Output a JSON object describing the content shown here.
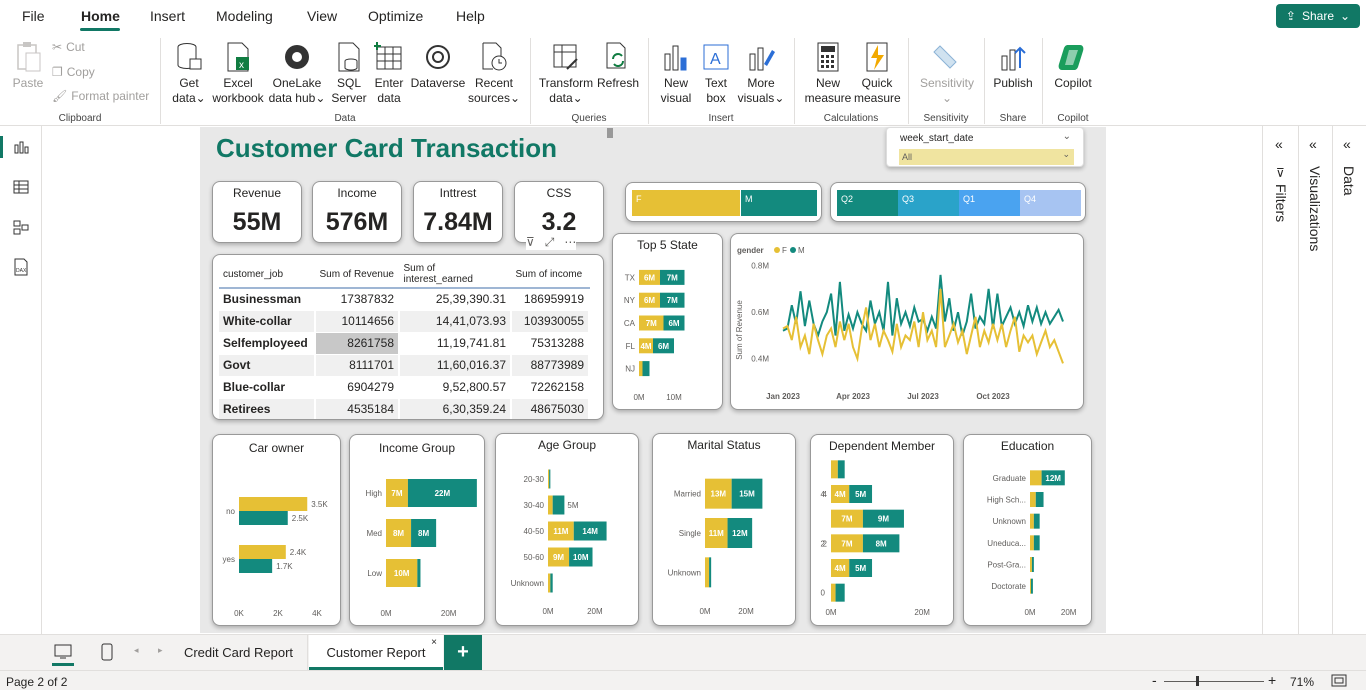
{
  "menu": {
    "file": "File",
    "home": "Home",
    "insert": "Insert",
    "modeling": "Modeling",
    "view": "View",
    "optimize": "Optimize",
    "help": "Help",
    "share": "Share"
  },
  "ribbon": {
    "paste": "Paste",
    "cut": "Cut",
    "copy": "Copy",
    "format_painter": "Format painter",
    "clipboard": "Clipboard",
    "get_data": [
      "Get",
      "data"
    ],
    "excel": [
      "Excel",
      "workbook"
    ],
    "onelake": [
      "OneLake",
      "data hub"
    ],
    "sql": [
      "SQL",
      "Server"
    ],
    "enter": [
      "Enter",
      "data"
    ],
    "dataverse": "Dataverse",
    "recent": [
      "Recent",
      "sources"
    ],
    "data_group": "Data",
    "transform": [
      "Transform",
      "data"
    ],
    "refresh": "Refresh",
    "queries": "Queries",
    "new_visual": [
      "New",
      "visual"
    ],
    "text_box": [
      "Text",
      "box"
    ],
    "more_visuals": [
      "More",
      "visuals"
    ],
    "insert_group": "Insert",
    "new_measure": [
      "New",
      "measure"
    ],
    "quick_measure": [
      "Quick",
      "measure"
    ],
    "calculations": "Calculations",
    "sensitivity": "Sensitivity",
    "sensitivity_group": "Sensitivity",
    "publish": "Publish",
    "share_group": "Share",
    "copilot": "Copilot",
    "copilot_group": "Copilot"
  },
  "report": {
    "title": "Customer Card Transaction",
    "slicer": {
      "label": "week_start_date",
      "value": "All"
    },
    "kpis": [
      {
        "label": "Revenue",
        "value": "55M"
      },
      {
        "label": "Income",
        "value": "576M"
      },
      {
        "label": "Inttrest",
        "value": "7.84M"
      },
      {
        "label": "CSS",
        "value": "3.2"
      }
    ],
    "gender_bar": {
      "f": "F",
      "m": "M"
    },
    "quarters": [
      "Q2",
      "Q3",
      "Q1",
      "Q4"
    ],
    "table": {
      "headers": [
        "customer_job",
        "Sum of Revenue",
        "Sum of interest_earned",
        "Sum of income"
      ],
      "rows": [
        [
          "Businessman",
          "17387832",
          "25,39,390.31",
          "186959919"
        ],
        [
          "White-collar",
          "10114656",
          "14,41,073.93",
          "103930055"
        ],
        [
          "Selfemployeed",
          "8261758",
          "11,19,741.81",
          "75313288"
        ],
        [
          "Govt",
          "8111701",
          "11,60,016.37",
          "88773989"
        ],
        [
          "Blue-collar",
          "6904279",
          "9,52,800.57",
          "72262158"
        ],
        [
          "Retirees",
          "4535184",
          "6,30,359.24",
          "48675030"
        ]
      ]
    },
    "visual_titles": {
      "top5": "Top 5 State",
      "car": "Car owner",
      "income": "Income Group",
      "age": "Age Group",
      "marital": "Marital Status",
      "dependent": "Dependent Member",
      "education": "Education"
    },
    "line": {
      "legend_title": "gender",
      "legend_f": "F",
      "legend_m": "M",
      "ylabel": "Sum of Revenue"
    }
  },
  "chart_data": [
    {
      "type": "bar",
      "title": "Top 5 State",
      "categories": [
        "TX",
        "NY",
        "CA",
        "FL",
        "NJ"
      ],
      "series": [
        {
          "name": "F",
          "values": [
            6,
            6,
            7,
            4,
            1
          ]
        },
        {
          "name": "M",
          "values": [
            7,
            7,
            6,
            6,
            2
          ]
        }
      ],
      "labels_f": [
        "6M",
        "6M",
        "7M",
        "4M",
        ""
      ],
      "labels_m": [
        "7M",
        "7M",
        "6M",
        "6M",
        ""
      ],
      "ticks": [
        "0M",
        "10M"
      ],
      "xmax": 20,
      "colors": {
        "F": "#e6c035",
        "M": "#138a7e"
      }
    },
    {
      "type": "line",
      "categories": [
        "Jan 2023",
        "Apr 2023",
        "Jul 2023",
        "Oct 2023"
      ],
      "yticks": [
        "0.4M",
        "0.6M",
        "0.8M"
      ],
      "yrange": [
        0.3,
        0.85
      ],
      "series": [
        {
          "name": "M",
          "values": [
            0.52,
            0.53,
            0.63,
            0.55,
            0.69,
            0.54,
            0.65,
            0.55,
            0.5,
            0.56,
            0.6,
            0.68,
            0.5,
            0.73,
            0.52,
            0.59,
            0.53,
            0.6,
            0.55,
            0.52,
            0.65,
            0.55,
            0.6,
            0.52,
            0.73,
            0.5,
            0.66,
            0.55,
            0.6,
            0.54,
            0.62,
            0.56,
            0.57,
            0.52,
            0.58,
            0.53,
            0.76,
            0.56,
            0.66,
            0.52,
            0.6,
            0.5,
            0.56,
            0.68,
            0.53,
            0.58,
            0.55,
            0.7,
            0.53,
            0.68,
            0.54,
            0.58,
            0.62,
            0.55,
            0.6,
            0.54,
            0.63,
            0.56,
            0.62,
            0.55,
            0.6,
            0.55,
            0.58,
            0.61,
            0.56
          ]
        },
        {
          "name": "F",
          "values": [
            0.53,
            0.54,
            0.48,
            0.58,
            0.45,
            0.5,
            0.42,
            0.55,
            0.48,
            0.42,
            0.5,
            0.53,
            0.45,
            0.56,
            0.48,
            0.55,
            0.45,
            0.4,
            0.53,
            0.62,
            0.48,
            0.55,
            0.45,
            0.52,
            0.48,
            0.43,
            0.55,
            0.45,
            0.5,
            0.48,
            0.56,
            0.45,
            0.6,
            0.48,
            0.52,
            0.45,
            0.7,
            0.45,
            0.5,
            0.55,
            0.47,
            0.52,
            0.42,
            0.5,
            0.58,
            0.45,
            0.52,
            0.47,
            0.55,
            0.48,
            0.55,
            0.45,
            0.52,
            0.58,
            0.43,
            0.5,
            0.47,
            0.5,
            0.42,
            0.47,
            0.52,
            0.45,
            0.48,
            0.43,
            0.38
          ]
        }
      ]
    },
    {
      "type": "bar",
      "title": "Car owner",
      "categories": [
        "no",
        "yes"
      ],
      "series": [
        {
          "name": "F",
          "values": [
            3.5,
            2.4
          ]
        },
        {
          "name": "M",
          "values": [
            2.5,
            1.7
          ]
        }
      ],
      "labels_f": [
        "3.5K",
        "2.4K"
      ],
      "labels_m": [
        "2.5K",
        "1.7K"
      ],
      "ticks": [
        "0K",
        "2K",
        "4K"
      ],
      "xmax": 4
    },
    {
      "type": "bar",
      "title": "Income Group",
      "categories": [
        "High",
        "Med",
        "Low"
      ],
      "series": [
        {
          "name": "F",
          "values": [
            7,
            8,
            10
          ]
        },
        {
          "name": "M",
          "values": [
            22,
            8,
            1
          ]
        }
      ],
      "labels_f": [
        "7M",
        "8M",
        "10M"
      ],
      "labels_m": [
        "22M",
        "8M",
        ""
      ],
      "ticks": [
        "0M",
        "20M"
      ],
      "xmax": 30
    },
    {
      "type": "bar",
      "title": "Age Group",
      "categories": [
        "20-30",
        "30-40",
        "40-50",
        "50-60",
        "Unknown"
      ],
      "series": [
        {
          "name": "F",
          "values": [
            0.5,
            2,
            11,
            9,
            1
          ]
        },
        {
          "name": "M",
          "values": [
            0.5,
            5,
            14,
            10,
            1
          ]
        }
      ],
      "labels_f": [
        "",
        "",
        "11M",
        "9M",
        ""
      ],
      "labels_m": [
        "",
        "5M",
        "14M",
        "10M",
        ""
      ],
      "ticks": [
        "0M",
        "20M"
      ],
      "xmax": 35
    },
    {
      "type": "bar",
      "title": "Marital Status",
      "categories": [
        "Married",
        "Single",
        "Unknown"
      ],
      "series": [
        {
          "name": "F",
          "values": [
            13,
            11,
            2
          ]
        },
        {
          "name": "M",
          "values": [
            15,
            12,
            1
          ]
        }
      ],
      "labels_f": [
        "13M",
        "11M",
        ""
      ],
      "labels_m": [
        "15M",
        "12M",
        ""
      ],
      "ticks": [
        "0M",
        "20M"
      ],
      "xmax": 40
    },
    {
      "type": "bar",
      "title": "Dependent Member",
      "categories": [
        "",
        "4",
        "",
        "2",
        "",
        ""
      ],
      "yticks": [
        "4",
        "2",
        "0"
      ],
      "series": [
        {
          "name": "F",
          "values": [
            1.5,
            4,
            7,
            7,
            4,
            1
          ]
        },
        {
          "name": "M",
          "values": [
            1.5,
            5,
            9,
            8,
            5,
            2
          ]
        }
      ],
      "labels_f": [
        "",
        "4M",
        "7M",
        "7M",
        "4M",
        ""
      ],
      "labels_m": [
        "",
        "5M",
        "9M",
        "8M",
        "5M",
        ""
      ],
      "ticks": [
        "0M",
        "20M"
      ],
      "xmax": 25
    },
    {
      "type": "bar",
      "title": "Education",
      "categories": [
        "Graduate",
        "High Sch...",
        "Unknown",
        "Uneduca...",
        "Post-Gra...",
        "Doctorate"
      ],
      "series": [
        {
          "name": "F",
          "values": [
            6,
            3,
            2,
            2,
            1,
            0.5
          ]
        },
        {
          "name": "M",
          "values": [
            12,
            4,
            3,
            3,
            1,
            1
          ]
        }
      ],
      "labels_f": [
        "",
        "",
        "",
        "",
        "",
        ""
      ],
      "labels_m": [
        "12M",
        "",
        "",
        "",
        "",
        ""
      ],
      "ticks": [
        "0M",
        "20M"
      ],
      "xmax": 30
    }
  ],
  "panes": {
    "filters": "Filters",
    "visualizations": "Visualizations",
    "data": "Data"
  },
  "tabs": {
    "t1": "Credit Card Report",
    "t2": "Customer Report",
    "plus": "+"
  },
  "status": {
    "page": "Page 2 of 2",
    "zoom": "71%",
    "minus": "-",
    "plus": "+"
  }
}
